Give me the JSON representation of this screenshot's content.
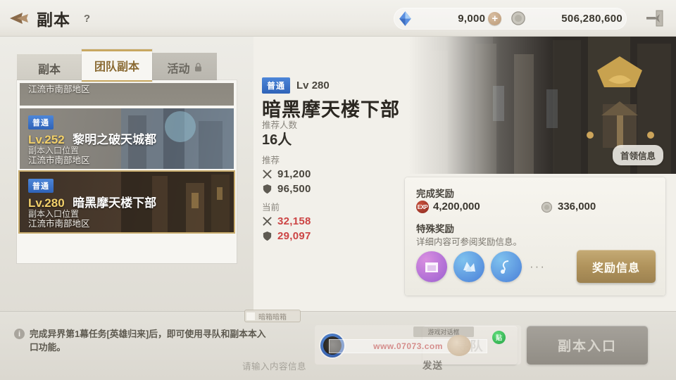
{
  "header": {
    "back_icon": "back-arrow-icon",
    "title": "副本",
    "help_icon": "?",
    "currency": {
      "gem_icon": "crystal-icon",
      "gem_value": "9,000",
      "plus_label": "+",
      "coin_icon": "coin-icon",
      "coin_value": "506,280,600"
    },
    "exit_icon": "exit-door-icon"
  },
  "tabs": [
    {
      "label": "副本",
      "state": "inactive",
      "locked": false
    },
    {
      "label": "团队副本",
      "state": "active",
      "locked": false
    },
    {
      "label": "活动",
      "state": "locked",
      "locked": true,
      "lock_icon": "lock-icon"
    }
  ],
  "dungeon_list": [
    {
      "partial": true,
      "location": "江流市南部地区"
    },
    {
      "partial": false,
      "selected": false,
      "difficulty": "普通",
      "level": "Lv.252",
      "name": "黎明之破天城都",
      "entry_label": "副本入口位置",
      "location": "江流市南部地区"
    },
    {
      "partial": false,
      "selected": true,
      "difficulty": "普通",
      "level": "Lv.280",
      "name": "暗黑摩天楼下部",
      "entry_label": "副本入口位置",
      "location": "江流市南部地区"
    }
  ],
  "mode_toggle": {
    "left_icon": "shield-banner-icon",
    "right_icon": "globe-helmet-icon",
    "active": "left"
  },
  "detail": {
    "boss_info_button": "首领信息",
    "difficulty": "普通",
    "level": "Lv 280",
    "name": "暗黑摩天楼下部",
    "party_label": "推荐人数",
    "party_value": "16人",
    "recommend_label": "推荐",
    "recommend_attack_icon": "swords-icon",
    "recommend_attack": "91,200",
    "recommend_defense_icon": "shield-icon",
    "recommend_defense": "96,500",
    "current_label": "当前",
    "current_attack_icon": "swords-icon",
    "current_attack": "32,158",
    "current_defense_icon": "shield-icon",
    "current_defense": "29,097",
    "current_color": "#cc4444"
  },
  "reward": {
    "complete_label": "完成奖励",
    "exp_icon": "EXP",
    "exp_value": "4,200,000",
    "gold_icon": "coin-icon",
    "gold_value": "336,000",
    "special_label": "特殊奖励",
    "special_desc": "详细内容可参阅奖励信息。",
    "item_icons": [
      "treasure-box-icon",
      "crystal-shard-icon",
      "pendant-icon"
    ],
    "more_dots": "···",
    "button_label": "奖励信息"
  },
  "bottom": {
    "info_icon": "i",
    "info_text": "完成异界第1幕任务[英雄归来]后，即可使用寻队和副本本入口功能。",
    "find_team_button": "寻队",
    "enter_dungeon_button": "副本入口"
  },
  "chat": {
    "avatar_icon": "user-avatar",
    "watermark_text": "www.07073.com",
    "watermark_tag": "游戏对话框",
    "status_badge": "贴",
    "placeholder": "请输入内容信息",
    "send_label": "发送",
    "float_tag": "暗箱暗箱"
  },
  "colors": {
    "accent_gold": "#c8a861",
    "tab_active_text": "#8a6a33",
    "badge_blue": "#2f63b8",
    "level_gold": "#f2d06a",
    "warn_red": "#cc4444"
  }
}
